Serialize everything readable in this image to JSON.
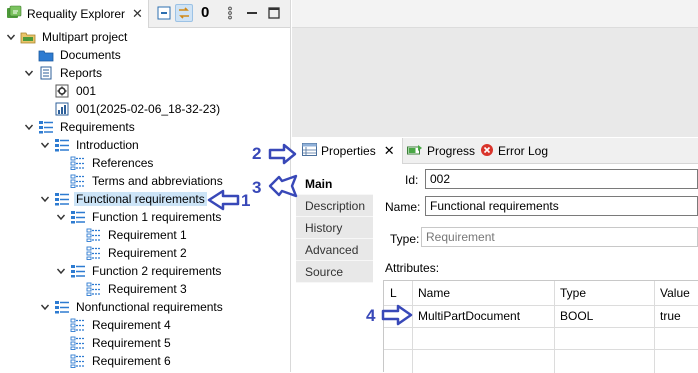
{
  "explorer": {
    "title": "Requality Explorer",
    "counter": "0"
  },
  "tree": [
    {
      "label": "Multipart project",
      "icon": "project-icon"
    },
    {
      "label": "Documents",
      "icon": "folder-icon"
    },
    {
      "label": "Reports",
      "icon": "reports-icon"
    },
    {
      "label": "001",
      "icon": "report-settings-icon"
    },
    {
      "label": "001(2025-02-06_18-32-23)",
      "icon": "report-chart-icon"
    },
    {
      "label": "Requirements",
      "icon": "requirement-group-icon"
    },
    {
      "label": "Introduction",
      "icon": "requirement-group-icon"
    },
    {
      "label": "References",
      "icon": "requirement-icon"
    },
    {
      "label": "Terms and abbreviations",
      "icon": "requirement-icon"
    },
    {
      "label": "Functional requirements",
      "icon": "requirement-group-icon"
    },
    {
      "label": "Function 1 requirements",
      "icon": "requirement-group-icon"
    },
    {
      "label": "Requirement 1",
      "icon": "requirement-icon"
    },
    {
      "label": "Requirement 2",
      "icon": "requirement-icon"
    },
    {
      "label": "Function 2 requirements",
      "icon": "requirement-group-icon"
    },
    {
      "label": "Requirement 3",
      "icon": "requirement-icon"
    },
    {
      "label": "Nonfunctional requirements",
      "icon": "requirement-group-icon"
    },
    {
      "label": "Requirement 4",
      "icon": "requirement-icon"
    },
    {
      "label": "Requirement 5",
      "icon": "requirement-icon"
    },
    {
      "label": "Requirement 6",
      "icon": "requirement-icon"
    }
  ],
  "views": {
    "properties": "Properties",
    "progress": "Progress",
    "error_log": "Error Log"
  },
  "prop_tabs": [
    "Main",
    "Description",
    "History",
    "Advanced",
    "Source"
  ],
  "fields": {
    "id_label": "Id:",
    "id_value": "002",
    "name_label": "Name:",
    "name_value": "Functional requirements",
    "type_label": "Type:",
    "type_value": "Requirement",
    "attributes_label": "Attributes:"
  },
  "attributes": {
    "columns": [
      "L",
      "Name",
      "Type",
      "Value"
    ],
    "rows": [
      {
        "l": "",
        "name": "MultiPartDocument",
        "type": "BOOL",
        "value": "true"
      }
    ]
  },
  "annotations": [
    "1",
    "2",
    "3",
    "4"
  ],
  "colors": {
    "annotation": "#3848b8",
    "selection": "#cce4f7",
    "icon_blue": "#2d7bd1"
  }
}
